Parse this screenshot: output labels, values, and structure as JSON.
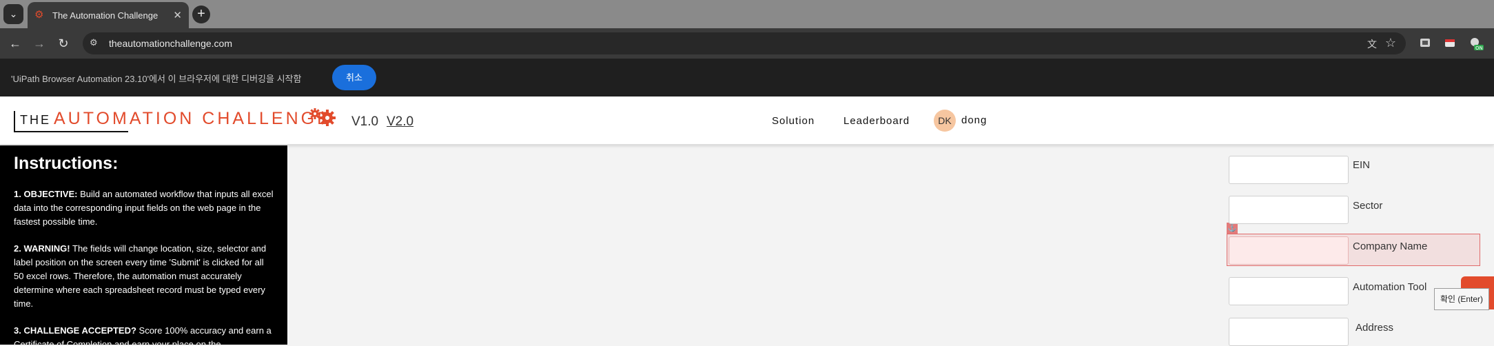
{
  "browser": {
    "tab_title": "The Automation Challenge",
    "url": "theautomationchallenge.com",
    "newtab_label": "+",
    "tab_close": "✕"
  },
  "infobar": {
    "message": "'UiPath Browser Automation 23.10'에서 이 브라우저에 대한 디버깅을 시작함",
    "cancel_label": "취소"
  },
  "header": {
    "logo_the": "THE",
    "logo_main": "AUTOMATION CHALLENGE",
    "version_1": "V1.0",
    "version_2": "V2.0",
    "nav_solution": "Solution",
    "nav_leaderboard": "Leaderboard",
    "user_initials": "DK",
    "user_name": "dong"
  },
  "instructions": {
    "heading": "Instructions:",
    "items": [
      {
        "lead": "1. OBJECTIVE:",
        "text": " Build an automated workflow that inputs all excel data into the corresponding input fields on the web page in the fastest possible time."
      },
      {
        "lead": "2. WARNING!",
        "text": " The fields will change location, size, selector and label position on the screen every time 'Submit' is clicked for all 50 excel rows. Therefore, the automation must accurately determine where each spreadsheet record must be typed every time."
      },
      {
        "lead": "3. CHALLENGE ACCEPTED?",
        "text": " Score 100% accuracy and earn a Certificate of Completion and earn your place on the"
      }
    ]
  },
  "form": {
    "fields": [
      {
        "label": "EIN",
        "value": ""
      },
      {
        "label": "Sector",
        "value": ""
      },
      {
        "label": "Company Name",
        "value": ""
      },
      {
        "label": "Automation Tool",
        "value": ""
      },
      {
        "label": "Address",
        "value": ""
      }
    ]
  },
  "overlay": {
    "confirm_label": "확인 (Enter)",
    "anchor_glyph": "⚓"
  },
  "colors": {
    "brand_orange": "#e24b2c",
    "cancel_blue": "#1a6fdc",
    "highlight_red": "#e06b6b"
  }
}
